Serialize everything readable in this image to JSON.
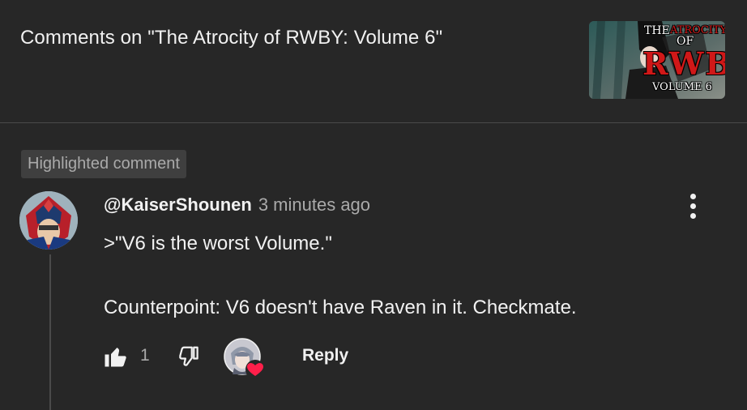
{
  "header": {
    "title": "Comments on \"The Atrocity of RWBY: Volume 6\"",
    "thumbnail": {
      "line1": "THE",
      "line1b": "ATROCITY",
      "line2": "OF",
      "line3": "RWBY",
      "line4": "VOLUME 6",
      "accent": "#d01818"
    }
  },
  "badge": {
    "label": "Highlighted comment"
  },
  "comment": {
    "author": "@KaiserShounen",
    "time": "3 minutes ago",
    "lines": [
      ">\"V6 is the worst Volume.\"",
      "Counterpoint: V6 doesn't have Raven in it. Checkmate."
    ],
    "likes": "1",
    "reply_label": "Reply"
  },
  "icons": {
    "menu": "more-vert-icon",
    "like": "thumbs-up-icon",
    "dislike": "thumbs-down-icon",
    "heart": "heart-icon"
  },
  "colors": {
    "background": "#272727",
    "heart": "#ff1f4a"
  }
}
